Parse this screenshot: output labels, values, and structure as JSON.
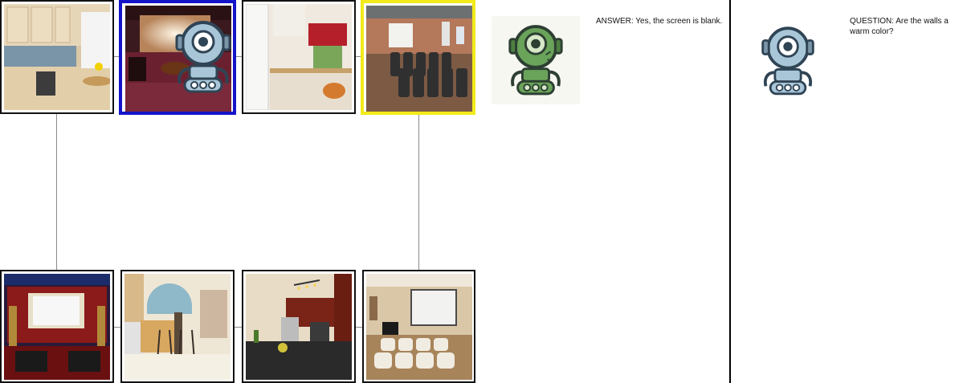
{
  "grid": {
    "top_row": [
      {
        "scene": "kitchen",
        "highlight": "none"
      },
      {
        "scene": "home-theater",
        "highlight": "blue"
      },
      {
        "scene": "kitchen",
        "highlight": "none"
      },
      {
        "scene": "home-theater",
        "highlight": "yellow"
      }
    ],
    "bottom_row": [
      {
        "scene": "home-theater",
        "highlight": "none"
      },
      {
        "scene": "kitchen",
        "highlight": "none"
      },
      {
        "scene": "kitchen",
        "highlight": "none"
      },
      {
        "scene": "home-theater",
        "highlight": "none"
      }
    ]
  },
  "answerer": {
    "avatar_icon": "green-robot-icon",
    "avatar_color": "#6aa35a",
    "text": "ANSWER: Yes, the screen is blank."
  },
  "questioner": {
    "avatar_icon": "blue-robot-icon",
    "avatar_color": "#a9c6d8",
    "text": "QUESTION: Are the walls a warm color?"
  },
  "colors": {
    "highlight_blue": "#1414c8",
    "highlight_yellow": "#f2ea1a",
    "connector": "#8a8a8a"
  }
}
